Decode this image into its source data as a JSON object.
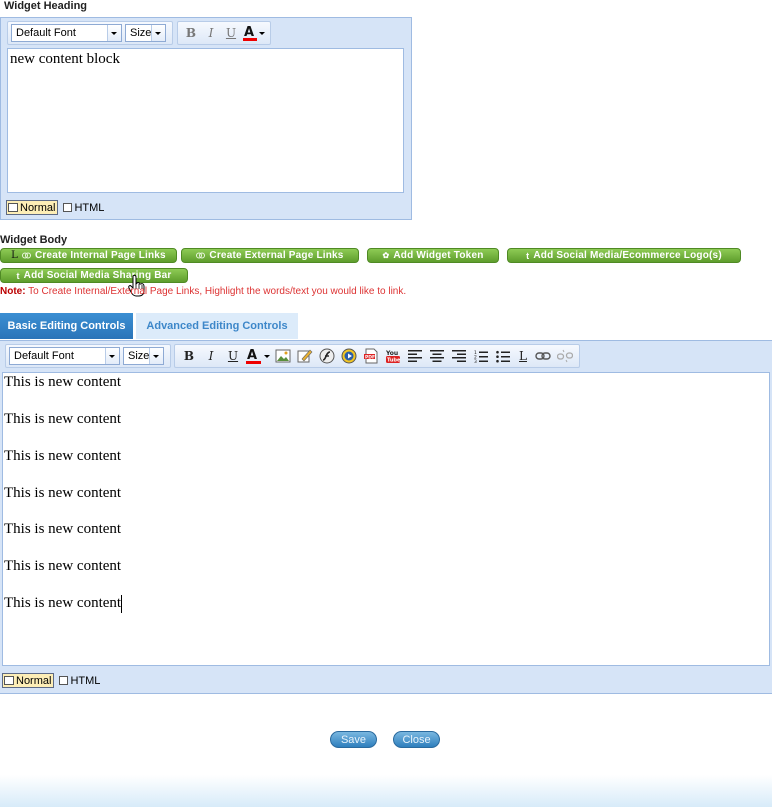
{
  "heading_section": {
    "title": "Widget Heading",
    "font_select": "Default Font",
    "size_select": "Size",
    "content": "new content block",
    "mode_normal": "Normal",
    "mode_html": "HTML"
  },
  "body_section": {
    "title": "Widget Body",
    "buttons": {
      "internal_links": "Create Internal Page Links",
      "external_links": "Create External Page Links",
      "widget_token": "Add Widget Token",
      "social_logos": "Add Social Media/Ecommerce Logo(s)",
      "sharing_bar": "Add Social Media Sharing Bar"
    },
    "note_label": "Note:",
    "note_text": " To Create Internal/External Page Links, Highlight the words/text you would like to link.",
    "tabs": {
      "basic": "Basic Editing Controls",
      "advanced": "Advanced Editing Controls"
    },
    "font_select": "Default Font",
    "size_select": "Size",
    "content_lines": [
      "This is new content",
      "This is new content",
      "This is new content",
      "This is new content",
      "This is new content",
      "This is new content",
      "This is new content"
    ],
    "mode_normal": "Normal",
    "mode_html": "HTML"
  },
  "footer": {
    "save": "Save",
    "close": "Close"
  },
  "colors": {
    "toolbar_bg": "#d6e4f7",
    "green_button": "#6aa93a",
    "tab_active": "#2f7dc0",
    "note_red": "#d33333"
  }
}
